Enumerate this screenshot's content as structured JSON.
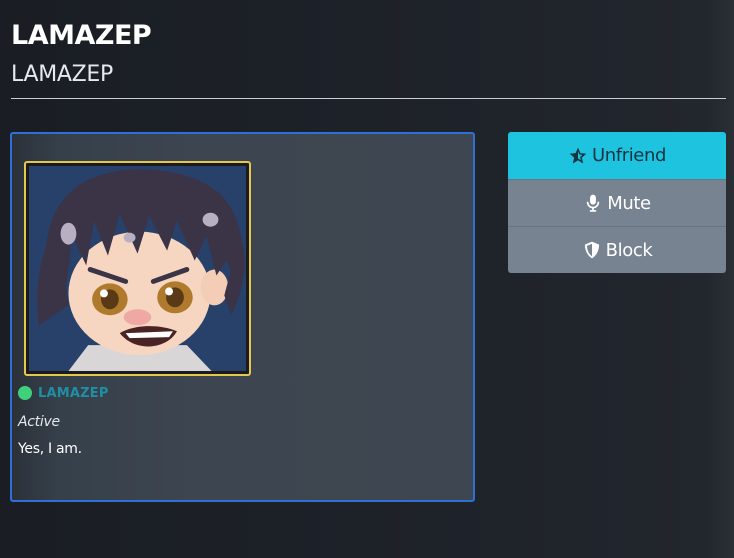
{
  "header": {
    "title": "LAMAZEP",
    "subtitle": "LAMAZEP"
  },
  "profile": {
    "username": "LAMAZEP",
    "status_color": "#3fd17a",
    "activity": "Active",
    "bio": "Yes, I am.",
    "avatar_icon": "chibi-anime-avatar"
  },
  "actions": {
    "unfriend_label": "Unfriend",
    "unfriend_icon": "star-icon",
    "mute_label": "Mute",
    "mute_icon": "microphone-icon",
    "block_label": "Block",
    "block_icon": "shield-icon"
  },
  "colors": {
    "accent": "#1ec3e0",
    "card_border": "#2f6fd6",
    "avatar_border": "#e3c84d",
    "username": "#1f8fa6"
  }
}
